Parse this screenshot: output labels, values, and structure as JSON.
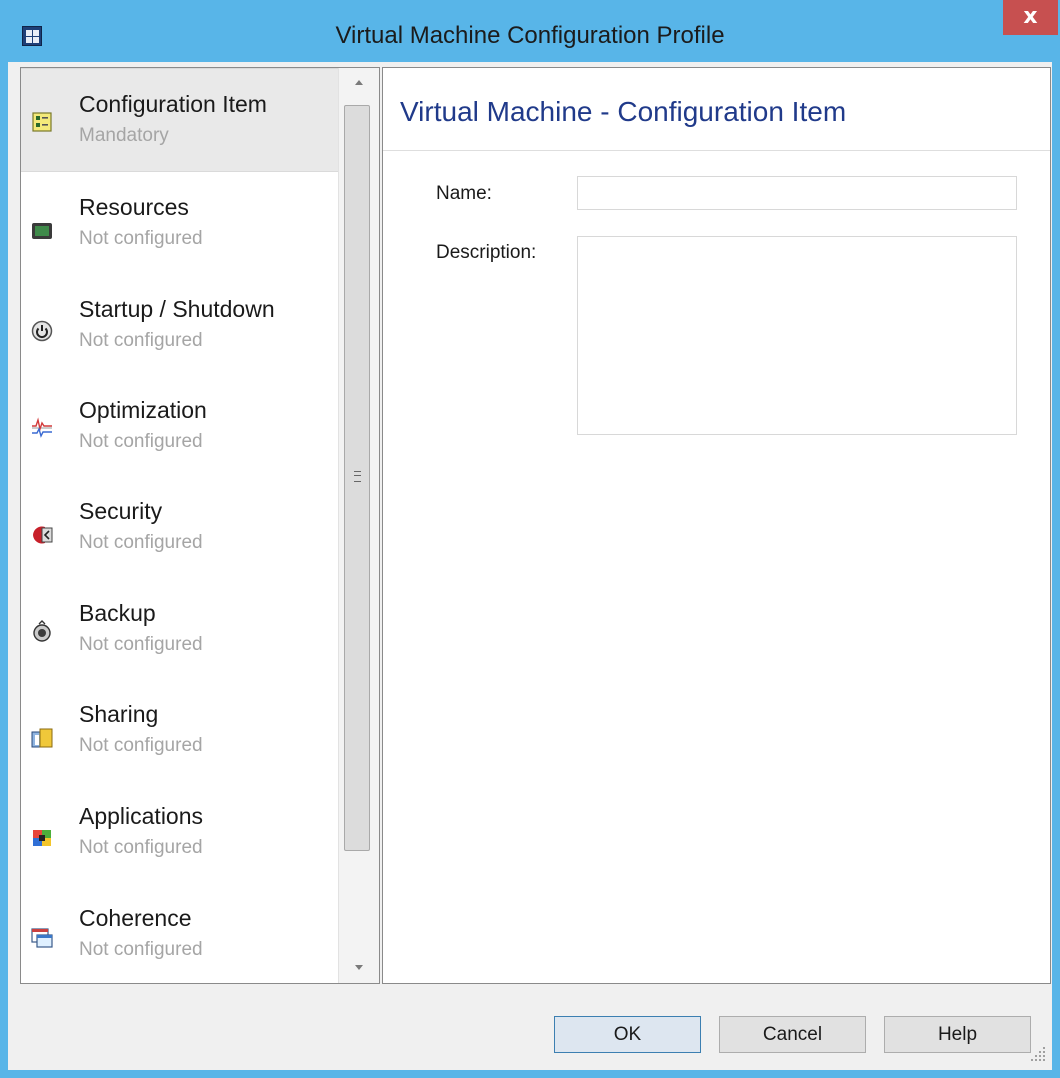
{
  "window": {
    "title": "Virtual Machine Configuration Profile",
    "close_label": "x",
    "accent_color": "#58b5e8",
    "close_color": "#c75050"
  },
  "sidebar": {
    "items": [
      {
        "label": "Configuration Item",
        "status": "Mandatory",
        "icon": "configuration-item-icon",
        "selected": true
      },
      {
        "label": "Resources",
        "status": "Not configured",
        "icon": "resources-icon"
      },
      {
        "label": "Startup / Shutdown",
        "status": "Not configured",
        "icon": "power-icon"
      },
      {
        "label": "Optimization",
        "status": "Not configured",
        "icon": "optimization-icon"
      },
      {
        "label": "Security",
        "status": "Not configured",
        "icon": "security-icon"
      },
      {
        "label": "Backup",
        "status": "Not configured",
        "icon": "backup-icon"
      },
      {
        "label": "Sharing",
        "status": "Not configured",
        "icon": "sharing-icon"
      },
      {
        "label": "Applications",
        "status": "Not configured",
        "icon": "applications-icon"
      },
      {
        "label": "Coherence",
        "status": "Not configured",
        "icon": "coherence-icon"
      }
    ]
  },
  "main": {
    "title": "Virtual Machine - Configuration Item",
    "title_color": "#203a8a",
    "name_label": "Name:",
    "name_value": "",
    "description_label": "Description:",
    "description_value": ""
  },
  "footer": {
    "ok_label": "OK",
    "cancel_label": "Cancel",
    "help_label": "Help"
  }
}
